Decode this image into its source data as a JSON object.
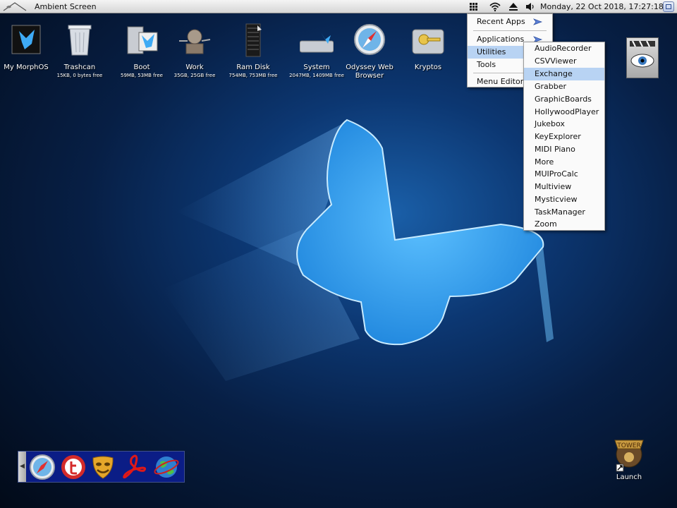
{
  "menubar": {
    "title": "Ambient Screen",
    "clock": "Monday, 22 Oct 2018, 17:27:18",
    "icons": [
      "app-grid-icon",
      "wifi-icon",
      "eject-icon",
      "volume-icon",
      "window-switch-icon"
    ]
  },
  "desktop_icons": [
    {
      "label": "My MorphOS",
      "sub": "",
      "icon": "morphos-butterfly-icon"
    },
    {
      "label": "Trashcan",
      "sub": "15KB, 0 bytes free",
      "icon": "trashcan-icon"
    },
    {
      "label": "Boot",
      "sub": "59MB, 53MB free",
      "icon": "boot-drive-icon"
    },
    {
      "label": "Work",
      "sub": "35GB, 25GB free",
      "icon": "work-drive-icon"
    },
    {
      "label": "Ram Disk",
      "sub": "754MB, 753MB free",
      "icon": "ram-disk-icon"
    },
    {
      "label": "System",
      "sub": "2047MB, 1409MB free",
      "icon": "system-drive-icon"
    },
    {
      "label": "Odyssey Web Browser",
      "sub": "",
      "icon": "compass-browser-icon"
    },
    {
      "label": "Kryptos",
      "sub": "",
      "icon": "key-drive-icon"
    }
  ],
  "main_menu": {
    "items": [
      {
        "label": "Recent Apps",
        "has_submenu": true
      },
      {
        "label": "Applications",
        "has_submenu": true
      },
      {
        "label": "Utilities",
        "has_submenu": true,
        "selected": true
      },
      {
        "label": "Tools",
        "has_submenu": false
      },
      {
        "label": "Menu Editor...",
        "has_submenu": false
      }
    ]
  },
  "utilities_menu": {
    "items": [
      "AudioRecorder",
      "CSVViewer",
      "Exchange",
      "Grabber",
      "GraphicBoards",
      "HollywoodPlayer",
      "Jukebox",
      "KeyExplorer",
      "MIDI Piano",
      "More",
      "MUIProCalc",
      "Multiview",
      "Mysticview",
      "TaskManager",
      "Zoom"
    ],
    "highlighted": "Exchange"
  },
  "dock": {
    "icons": [
      "compass-browser-icon",
      "twitter-bird-icon",
      "theater-mask-icon",
      "pdf-reader-icon",
      "globe-icon"
    ]
  },
  "launch": {
    "label": "Launch",
    "icon": "launch-game-icon"
  },
  "colors": {
    "menu_highlight": "#b8d3f3",
    "dock_bg": "#0b1d86",
    "butterfly": "#3eaaf4"
  }
}
